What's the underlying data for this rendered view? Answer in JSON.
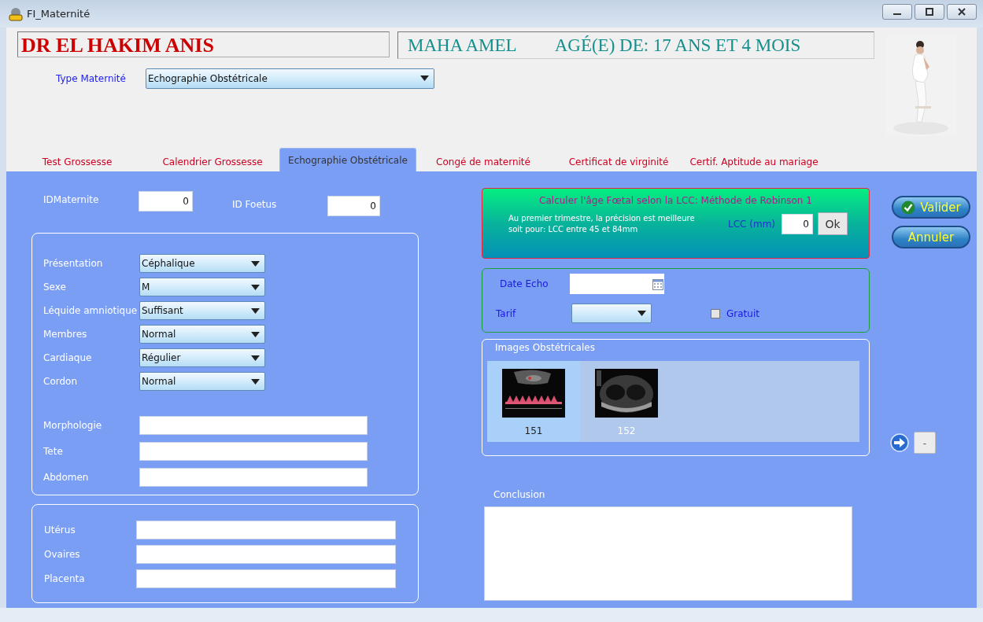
{
  "window": {
    "title": "FI_Maternité"
  },
  "doctor": "DR EL HAKIM ANIS",
  "patient": {
    "name": "MAHA AMEL",
    "age": "AGÉ(E) DE: 17 ANS ET 4 MOIS"
  },
  "type_field": {
    "label": "Type Maternité",
    "value": "Echographie Obstétricale"
  },
  "tabs": [
    {
      "label": "Test Grossesse",
      "selected": false
    },
    {
      "label": "Calendrier Grossesse",
      "selected": false
    },
    {
      "label": "Echographie Obstétricale",
      "selected": true
    },
    {
      "label": "Congé de maternité",
      "selected": false
    },
    {
      "label": "Certificat de virginité",
      "selected": false
    },
    {
      "label": "Certif. Aptitude au mariage",
      "selected": false
    }
  ],
  "id_maternite": {
    "label": "IDMaternite",
    "value": "0"
  },
  "id_foetus": {
    "label": "ID Foetus",
    "value": "0"
  },
  "selects": [
    {
      "label": "Présentation",
      "value": "Céphalique"
    },
    {
      "label": "Sexe",
      "value": "M"
    },
    {
      "label": "Léquide amniotique",
      "value": "Suffisant"
    },
    {
      "label": "Membres",
      "value": "Normal"
    },
    {
      "label": "Cardiaque",
      "value": "Régulier"
    },
    {
      "label": "Cordon",
      "value": "Normal"
    }
  ],
  "text_fields": [
    {
      "label": "Morphologie"
    },
    {
      "label": "Tete"
    },
    {
      "label": "Abdomen"
    }
  ],
  "lower_fields": [
    {
      "label": "Utérus"
    },
    {
      "label": "Ovaires"
    },
    {
      "label": "Placenta"
    }
  ],
  "lcc": {
    "title": "Calculer l'âge Fœtal selon la LCC: Méthode de Robinson 1",
    "note": [
      "Au premier trimestre, la précision est meilleure",
      "soit pour: LCC entre 45 et 84mm"
    ],
    "label": "LCC (mm)",
    "value": "0",
    "button": "Ok"
  },
  "date_echo": {
    "label": "Date Echo"
  },
  "tarif": {
    "label": "Tarif"
  },
  "gratuit": {
    "label": "Gratuit",
    "checked": false
  },
  "images": {
    "title": "Images Obstétricales",
    "items": [
      {
        "caption": "151",
        "selected": true,
        "kind": "doppler"
      },
      {
        "caption": "152",
        "selected": false,
        "kind": "scan"
      }
    ]
  },
  "conclusion": {
    "label": "Conclusion"
  },
  "actions": {
    "validate": "Valider",
    "cancel": "Annuler",
    "minus": "-"
  }
}
